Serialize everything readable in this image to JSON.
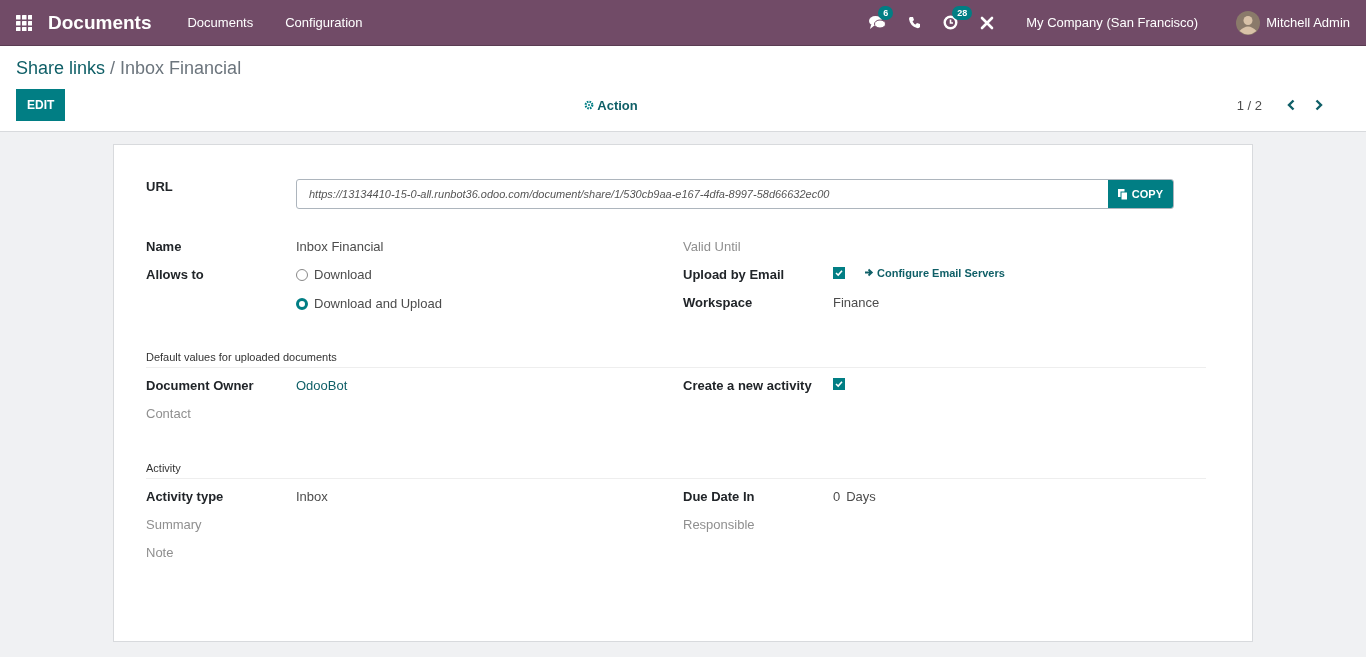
{
  "navbar": {
    "app_name": "Documents",
    "menus": [
      "Documents",
      "Configuration"
    ],
    "messages_count": "6",
    "activities_count": "28",
    "company": "My Company (San Francisco)",
    "user": "Mitchell Admin"
  },
  "breadcrumb": {
    "parent": "Share links",
    "separator": "/",
    "current": "Inbox Financial"
  },
  "controls": {
    "edit": "EDIT",
    "action": "Action",
    "pager": "1 / 2"
  },
  "url": {
    "label": "URL",
    "value": "https://13134410-15-0-all.runbot36.odoo.com/document/share/1/530cb9aa-e167-4dfa-8997-58d66632ec00",
    "copy": "COPY"
  },
  "sections": [
    {
      "left": [
        {
          "kind": "text",
          "label": "Name",
          "value": "Inbox Financial"
        },
        {
          "kind": "radio",
          "label": "Allows to",
          "options": [
            {
              "label": "Download",
              "selected": false
            },
            {
              "label": "Download and Upload",
              "selected": true
            }
          ]
        }
      ],
      "right": [
        {
          "kind": "text",
          "label": "Valid Until"
        },
        {
          "kind": "checkbox",
          "label": "Upload by Email",
          "checked": true,
          "link": "Configure Email Servers"
        },
        {
          "kind": "text",
          "label": "Workspace",
          "value": "Finance"
        }
      ]
    },
    {
      "title": "Default values for uploaded documents",
      "left": [
        {
          "kind": "link",
          "label": "Document Owner",
          "value": "OdooBot"
        },
        {
          "kind": "text",
          "label": "Contact"
        }
      ],
      "right": [
        {
          "kind": "checkbox",
          "label": "Create a new activity",
          "checked": true
        }
      ]
    },
    {
      "title": "Activity",
      "left": [
        {
          "kind": "text",
          "label": "Activity type",
          "value": "Inbox"
        },
        {
          "kind": "text",
          "label": "Summary"
        },
        {
          "kind": "text",
          "label": "Note"
        }
      ],
      "right": [
        {
          "kind": "days",
          "label": "Due Date In",
          "value": "0",
          "unit": "Days"
        },
        {
          "kind": "text",
          "label": "Responsible"
        }
      ]
    }
  ]
}
